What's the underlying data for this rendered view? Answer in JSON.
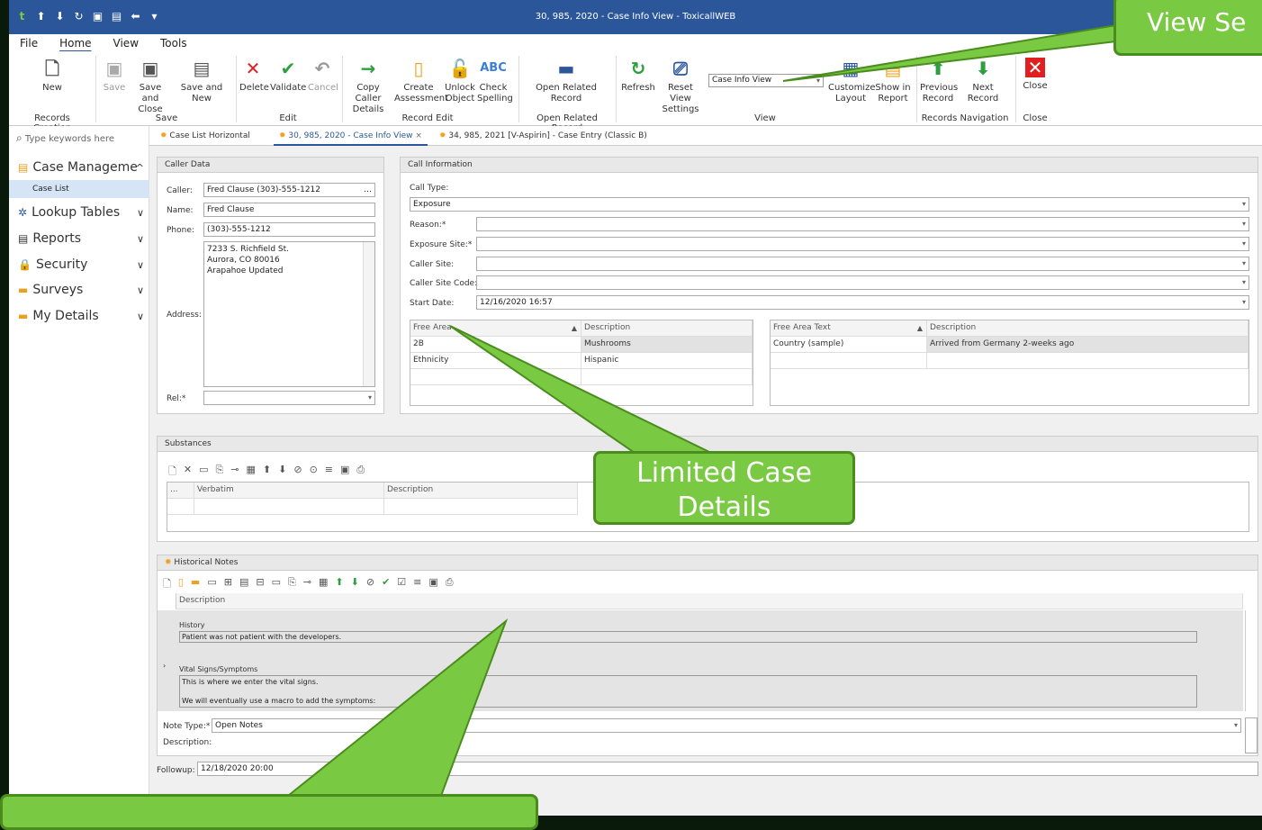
{
  "window": {
    "title": "30, 985, 2020 - Case Info View - ToxicallWEB"
  },
  "menu": [
    "File",
    "Home",
    "View",
    "Tools"
  ],
  "ribbon": {
    "buttons": {
      "new": "New",
      "save": "Save",
      "save_close": "Save and Close",
      "save_new": "Save and New",
      "delete": "Delete",
      "validate": "Validate",
      "cancel": "Cancel",
      "copy_caller": "Copy Caller Details",
      "create_assessment": "Create Assessment",
      "unlock": "Unlock Object",
      "check_spelling": "Check Spelling",
      "open_related": "Open Related Record",
      "refresh": "Refresh",
      "reset_view": "Reset View Settings",
      "customize": "Customize Layout",
      "show_report": "Show in Report",
      "prev": "Previous Record",
      "next": "Next Record",
      "close": "Close"
    },
    "view_combo": "Case Info View",
    "groups": [
      "Records Creation",
      "Save",
      "Edit",
      "Record Edit",
      "Open Related Record",
      "View",
      "Records Navigation",
      "Close"
    ]
  },
  "sidebar": {
    "search_placeholder": "Type keywords here",
    "case_mgmt": "Case Manageme",
    "case_list": "Case List",
    "items": [
      "Lookup Tables",
      "Reports",
      "Security",
      "Surveys",
      "My Details"
    ]
  },
  "tabs": [
    "Case List Horizontal",
    "30, 985, 2020 - Case Info View",
    "34, 985, 2021 [V-Aspirin] - Case Entry (Classic B)"
  ],
  "caller": {
    "title": "Caller Data",
    "labels": {
      "caller": "Caller:",
      "name": "Name:",
      "phone": "Phone:",
      "address": "Address:",
      "rel": "Rel:*"
    },
    "caller": "Fred Clause (303)-555-1212",
    "name": "Fred  Clause",
    "phone": "(303)-555-1212",
    "address_lines": [
      "7233 S. Richfield St.",
      "Aurora, CO 80016",
      "Arapahoe Updated"
    ]
  },
  "call_info": {
    "title": "Call Information",
    "labels": {
      "call_type": "Call Type:",
      "reason": "Reason:*",
      "exposure_site": "Exposure Site:*",
      "caller_site": "Caller Site:",
      "caller_site_code": "Caller Site Code:",
      "start_date": "Start Date:"
    },
    "call_type": "Exposure",
    "start_date": "12/16/2020 16:57",
    "free_area": {
      "headers": [
        "Free Area",
        "Description"
      ],
      "rows": [
        [
          "2B",
          "Mushrooms"
        ],
        [
          "Ethnicity",
          "Hispanic"
        ]
      ]
    },
    "free_text": {
      "headers": [
        "Free Area Text",
        "Description"
      ],
      "rows": [
        [
          "Country (sample)",
          "Arrived from Germany 2-weeks ago"
        ]
      ]
    }
  },
  "substances": {
    "title": "Substances",
    "headers": [
      "...",
      "Verbatim",
      "Description"
    ]
  },
  "notes": {
    "title": "Historical Notes",
    "header": "Description",
    "history_label": "History",
    "history_text": "Patient was not patient with the developers.",
    "vital_label": "Vital Signs/Symptoms",
    "vital_line1": "This is where we enter the vital signs.",
    "vital_line2": "We will eventually use a macro to add the symptoms:",
    "note_type_label": "Note Type:*",
    "note_type": "Open Notes",
    "description_label": "Description:",
    "followup_label": "Followup:",
    "followup": "12/18/2020 20:00"
  },
  "callouts": {
    "limited": [
      "Limited Case",
      "Details"
    ],
    "view": "View Se"
  },
  "colors": {
    "title_bar": "#2b579a",
    "callout": "#7ac943",
    "callout_border": "#4a8c1e"
  }
}
